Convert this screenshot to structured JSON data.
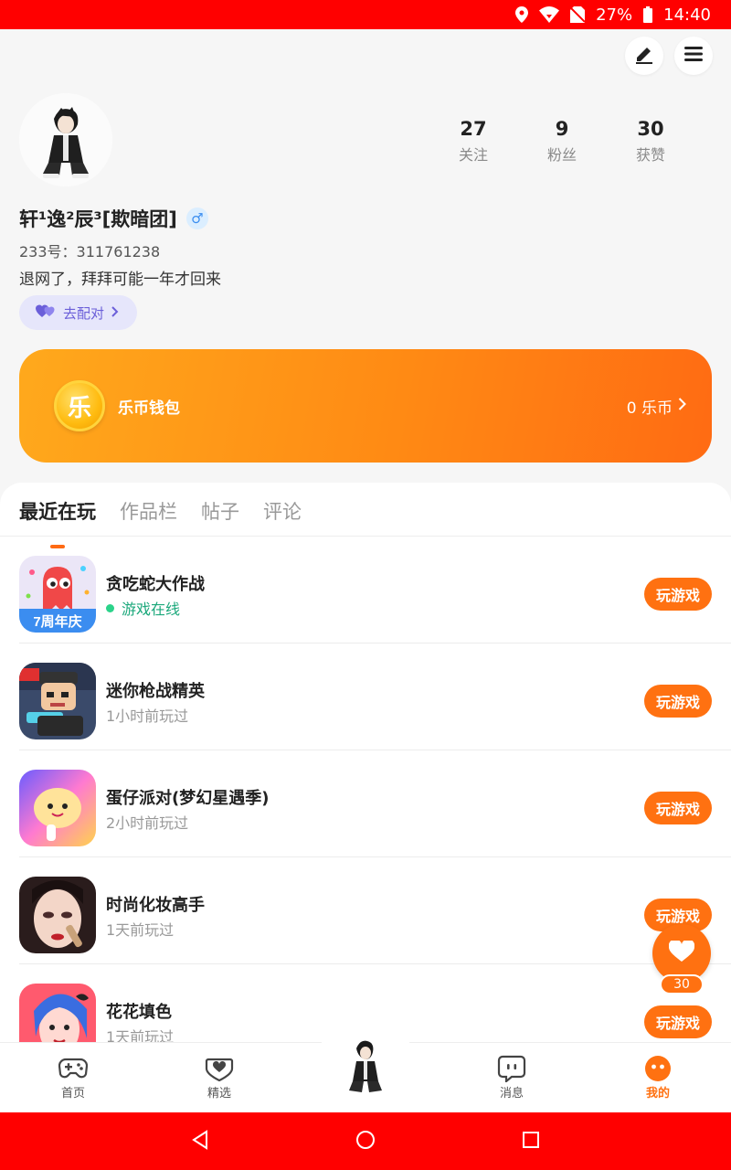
{
  "status_bar": {
    "battery": "27%",
    "time": "14:40"
  },
  "profile": {
    "stats": [
      {
        "value": "27",
        "label": "关注"
      },
      {
        "value": "9",
        "label": "粉丝"
      },
      {
        "value": "30",
        "label": "获赞"
      }
    ],
    "name": "轩¹逸²辰³[欺暗团]",
    "gender_symbol": "♂",
    "uid": "233号：311761238",
    "bio": "退网了，拜拜可能一年才回来",
    "match_label": "去配对"
  },
  "wallet": {
    "coin_char": "乐",
    "label": "乐币钱包",
    "balance": "0 乐币"
  },
  "tabs": [
    {
      "label": "最近在玩",
      "active": true
    },
    {
      "label": "作品栏"
    },
    {
      "label": "帖子"
    },
    {
      "label": "评论"
    }
  ],
  "games": [
    {
      "title": "贪吃蛇大作战",
      "subtitle": "游戏在线",
      "button": "玩游戏"
    },
    {
      "title": "迷你枪战精英",
      "subtitle": "1小时前玩过",
      "button": "玩游戏"
    },
    {
      "title": "蛋仔派对(梦幻星遇季)",
      "subtitle": "2小时前玩过",
      "button": "玩游戏"
    },
    {
      "title": "时尚化妆高手",
      "subtitle": "1天前玩过",
      "button": "玩游戏"
    },
    {
      "title": "花花填色",
      "subtitle": "1天前玩过",
      "button": "玩游戏"
    }
  ],
  "game_icon_text": {
    "snake": "7周年庆"
  },
  "like": {
    "count": "30"
  },
  "bottom_nav": [
    {
      "label": "首页",
      "icon": "gamepad-icon"
    },
    {
      "label": "精选",
      "icon": "heart-chat-icon"
    },
    {
      "label": "消息",
      "icon": "message-icon"
    },
    {
      "label": "我的",
      "icon": "face-icon",
      "active": true
    }
  ],
  "colors": {
    "accent": "#ff7111",
    "status_bar": "#ff0000",
    "online": "#1ba87b",
    "match": "#6b5fd9"
  }
}
